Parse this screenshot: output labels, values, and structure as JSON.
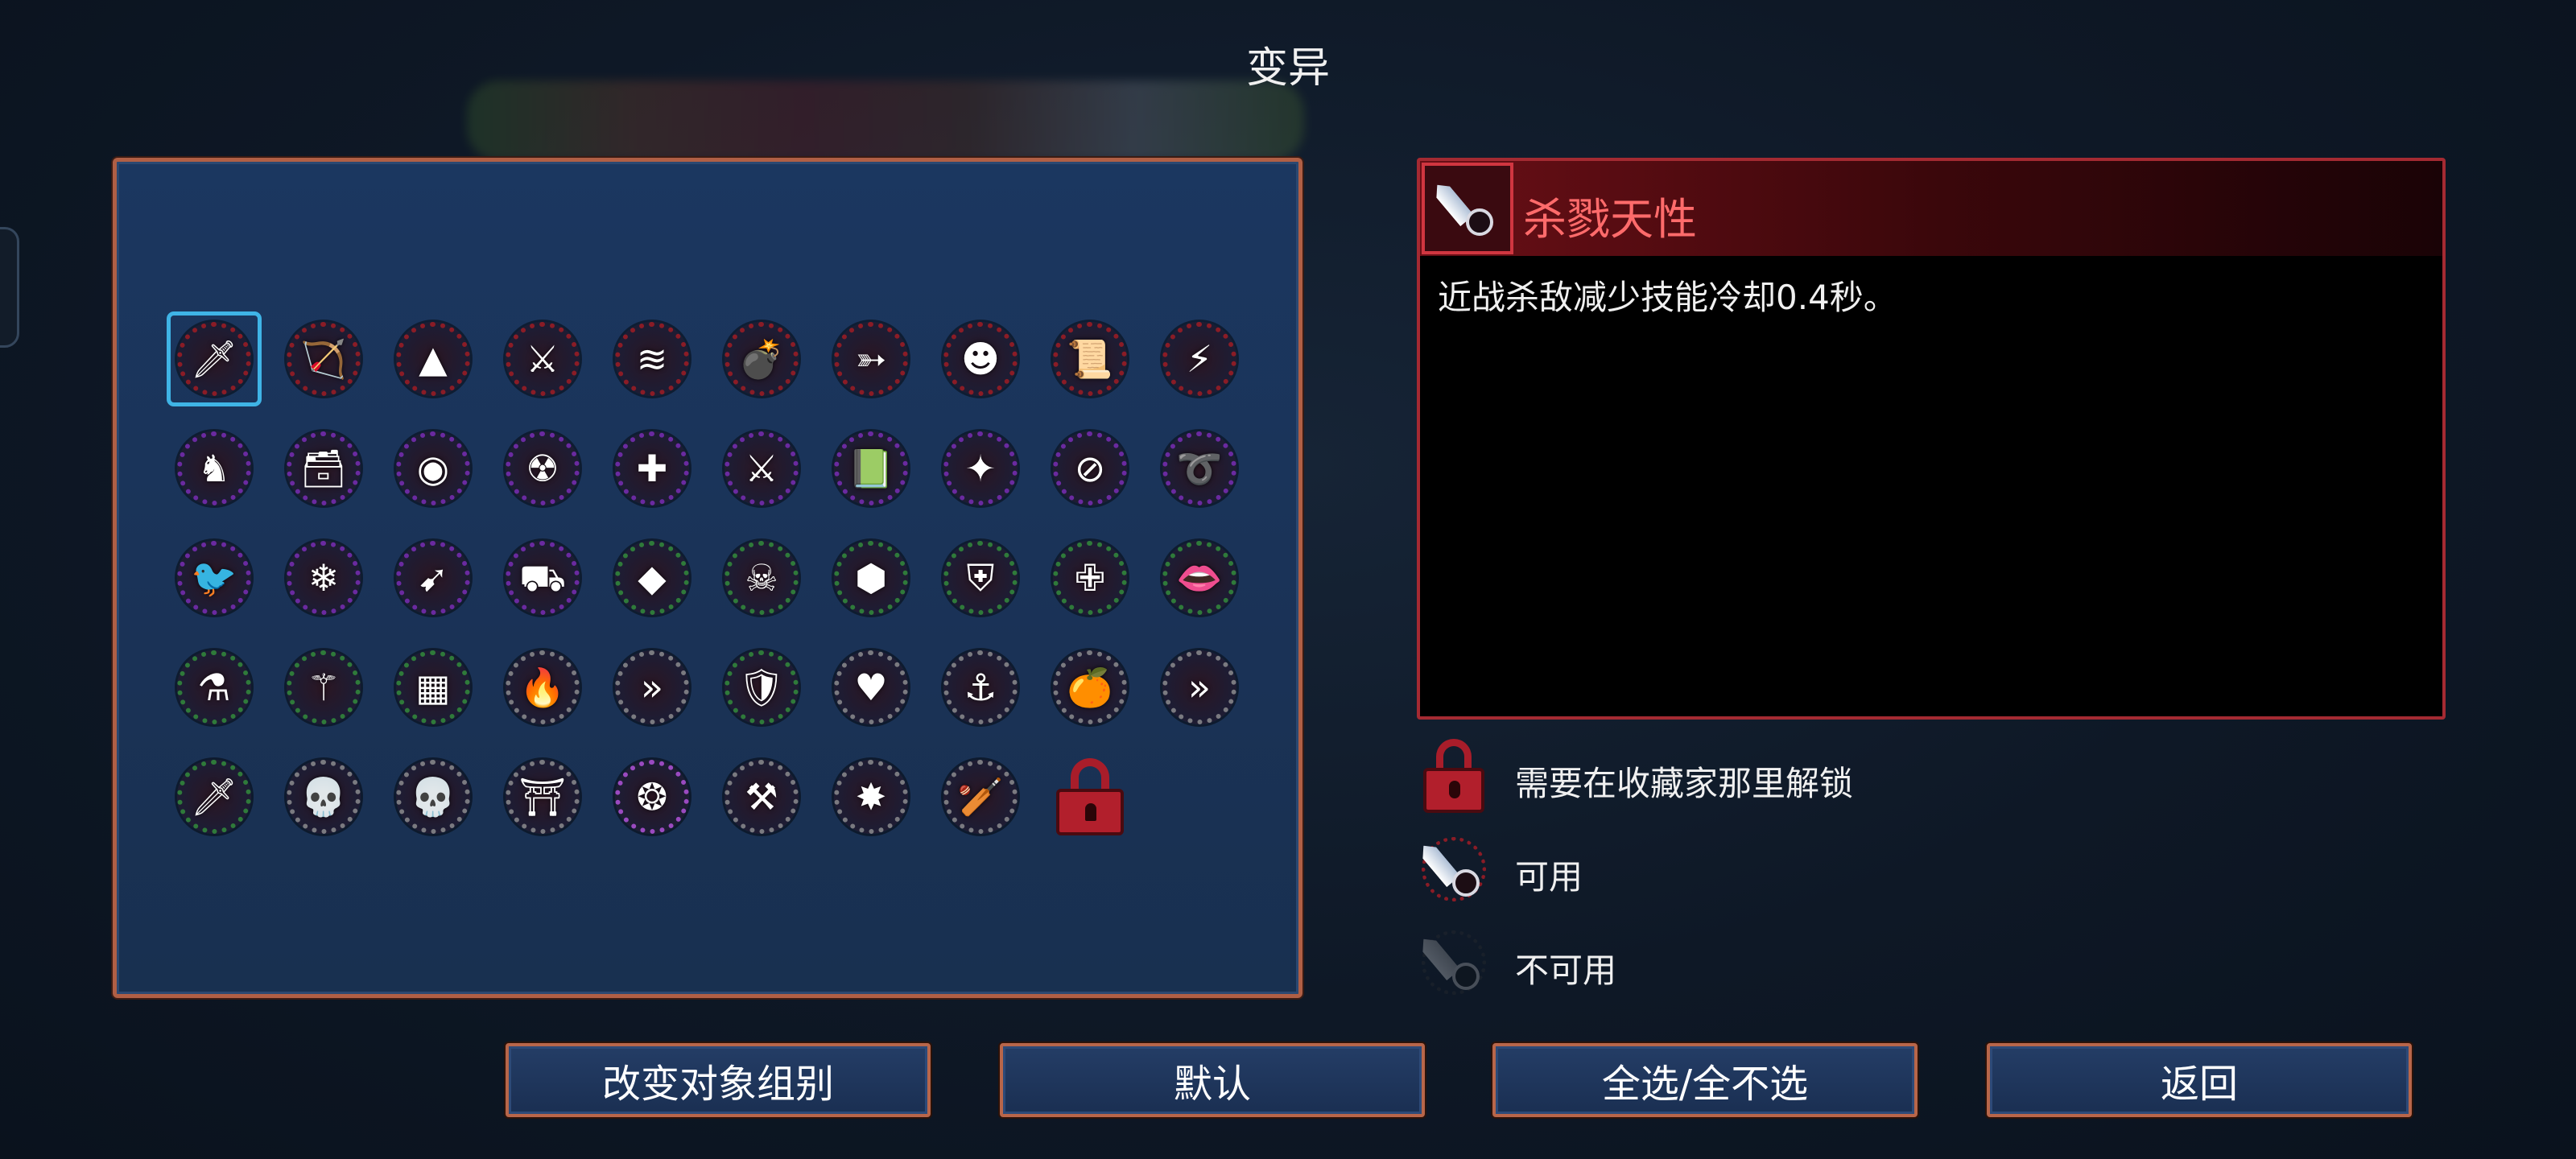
{
  "title": "变异",
  "grid": {
    "cells": [
      {
        "icon": "sword-icon",
        "glyph": "🗡",
        "rim": "#8a1c26",
        "selected": true
      },
      {
        "icon": "bow-icon",
        "glyph": "🏹",
        "rim": "#8a1c26"
      },
      {
        "icon": "triangle-eye-icon",
        "glyph": "▲",
        "rim": "#8a1c26"
      },
      {
        "icon": "ice-scythe-icon",
        "glyph": "⚔",
        "rim": "#8a1c26"
      },
      {
        "icon": "claw-marks-icon",
        "glyph": "≋",
        "rim": "#8a1c26"
      },
      {
        "icon": "bomb-icon",
        "glyph": "💣",
        "rim": "#8a1c26"
      },
      {
        "icon": "rifle-icon",
        "glyph": "➳",
        "rim": "#8a1c26"
      },
      {
        "icon": "red-mask-icon",
        "glyph": "☻",
        "rim": "#8a1c26"
      },
      {
        "icon": "blue-scroll-icon",
        "glyph": "📜",
        "rim": "#8a1c26"
      },
      {
        "icon": "lightning-scroll-icon",
        "glyph": "⚡",
        "rim": "#8a1c26"
      },
      {
        "icon": "hooded-figure-icon",
        "glyph": "♞",
        "rim": "#6a2aa0"
      },
      {
        "icon": "chest-dagger-icon",
        "glyph": "🗃",
        "rim": "#6a2aa0"
      },
      {
        "icon": "orb-icon",
        "glyph": "◉",
        "rim": "#6a2aa0"
      },
      {
        "icon": "jester-bomb-icon",
        "glyph": "☢",
        "rim": "#6a2aa0"
      },
      {
        "icon": "red-cross-icon",
        "glyph": "✚",
        "rim": "#6a2aa0"
      },
      {
        "icon": "twin-blades-icon",
        "glyph": "⚔",
        "rim": "#6a2aa0"
      },
      {
        "icon": "green-scroll-icon",
        "glyph": "📗",
        "rim": "#6a2aa0"
      },
      {
        "icon": "star-hammer-icon",
        "glyph": "✦",
        "rim": "#6a2aa0"
      },
      {
        "icon": "no-arrow-icon",
        "glyph": "⊘",
        "rim": "#6a2aa0"
      },
      {
        "icon": "whip-icon",
        "glyph": "➰",
        "rim": "#6a2aa0"
      },
      {
        "icon": "blue-bird-icon",
        "glyph": "🐦",
        "rim": "#6a2aa0"
      },
      {
        "icon": "frost-gun-icon",
        "glyph": "❄",
        "rim": "#6a2aa0"
      },
      {
        "icon": "crossbow-icon",
        "glyph": "➹",
        "rim": "#6a2aa0"
      },
      {
        "icon": "chest-gun-icon",
        "glyph": "⛟",
        "rim": "#6a2aa0"
      },
      {
        "icon": "purple-gem-icon",
        "glyph": "◆",
        "rim": "#2f7a3a"
      },
      {
        "icon": "skull-crossbones-icon",
        "glyph": "☠",
        "rim": "#2f7a3a"
      },
      {
        "icon": "blue-shield-icon",
        "glyph": "⬢",
        "rim": "#2f7a3a"
      },
      {
        "icon": "golden-shield-icon",
        "glyph": "⛨",
        "rim": "#2f7a3a"
      },
      {
        "icon": "green-cross-shield-icon",
        "glyph": "✙",
        "rim": "#2f7a3a"
      },
      {
        "icon": "vampire-fangs-icon",
        "glyph": "👄",
        "rim": "#2f7a3a"
      },
      {
        "icon": "potion-icon",
        "glyph": "⚗",
        "rim": "#2f7a3a"
      },
      {
        "icon": "staff-icon",
        "glyph": "⚚",
        "rim": "#2f7a3a"
      },
      {
        "icon": "blue-gate-icon",
        "glyph": "▦",
        "rim": "#2f7a3a"
      },
      {
        "icon": "fire-drop-icon",
        "glyph": "🔥",
        "rim": "#7a7a80"
      },
      {
        "icon": "double-chevron-red-icon",
        "glyph": "»",
        "rim": "#7a7a80"
      },
      {
        "icon": "chest-shield-icon",
        "glyph": "🛡",
        "rim": "#2f7a3a"
      },
      {
        "icon": "heart-shield-icon",
        "glyph": "♥",
        "rim": "#7a7a80"
      },
      {
        "icon": "golden-hook-icon",
        "glyph": "⚓",
        "rim": "#7a7a80"
      },
      {
        "icon": "orange-potion-icon",
        "glyph": "🍊",
        "rim": "#7a7a80"
      },
      {
        "icon": "double-chevron-gold-icon",
        "glyph": "»",
        "rim": "#7a7a80"
      },
      {
        "icon": "green-dagger-icon",
        "glyph": "🗡",
        "rim": "#2f7a3a"
      },
      {
        "icon": "green-skull-icon",
        "glyph": "💀",
        "rim": "#7a7a80"
      },
      {
        "icon": "blue-skull-icon",
        "glyph": "💀",
        "rim": "#7a7a80"
      },
      {
        "icon": "ice-gate-icon",
        "glyph": "⛩",
        "rim": "#7a7a80"
      },
      {
        "icon": "purple-rune-icon",
        "glyph": "❂",
        "rim": "#9a4ac0"
      },
      {
        "icon": "battle-axe-icon",
        "glyph": "⚒",
        "rim": "#7a7a80"
      },
      {
        "icon": "golden-sunburst-icon",
        "glyph": "✸",
        "rim": "#7a7a80"
      },
      {
        "icon": "chained-club-icon",
        "glyph": "🏏",
        "rim": "#7a7a80"
      },
      {
        "icon": "padlock-icon",
        "glyph": "",
        "rim": "#a81d2a",
        "locked": true
      }
    ]
  },
  "detail": {
    "icon": "sword-icon",
    "title": "杀戮天性",
    "description": "近战杀敌减少技能冷却0.4秒。"
  },
  "legend": [
    {
      "icon": "padlock-icon",
      "text": "需要在收藏家那里解锁"
    },
    {
      "icon": "sword-icon",
      "text": "可用"
    },
    {
      "icon": "sword-dim-icon",
      "text": "不可用"
    }
  ],
  "buttons": {
    "change_group": "改变对象组别",
    "default": "默认",
    "select_all": "全选/全不选",
    "back": "返回"
  },
  "colors": {
    "panel_border": "#b05f45",
    "detail_border": "#a42a32",
    "title_red": "#ff6b6b",
    "selection_blue": "#3fb4e6"
  }
}
